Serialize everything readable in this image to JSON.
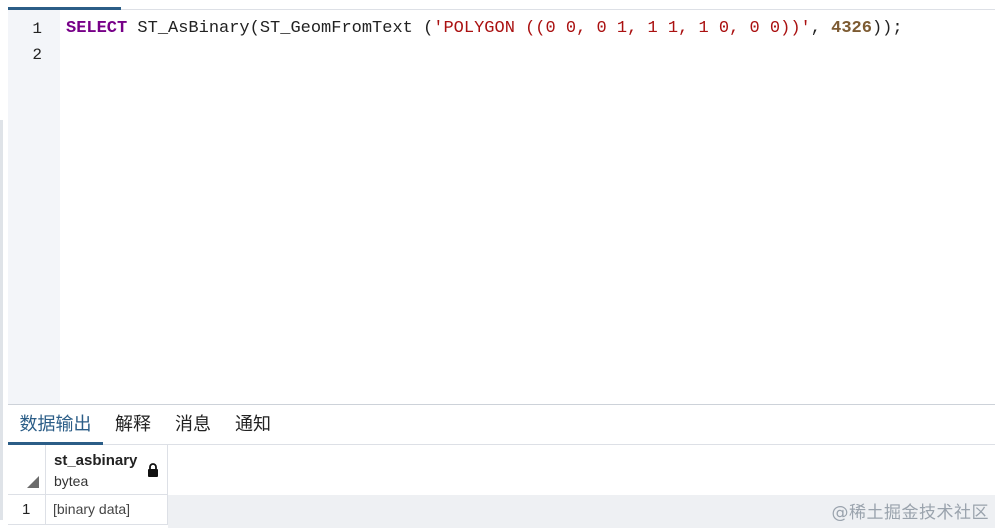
{
  "editor": {
    "line_numbers": [
      "1",
      "2"
    ],
    "code": {
      "keyword": "SELECT",
      "func_part": " ST_AsBinary(ST_GeomFromText (",
      "string_literal": "'POLYGON ((0 0, 0 1, 1 1, 1 0, 0 0))'",
      "sep": ", ",
      "srid": "4326",
      "end": "));"
    }
  },
  "result_tabs": [
    {
      "label": "数据输出",
      "active": true
    },
    {
      "label": "解释",
      "active": false
    },
    {
      "label": "消息",
      "active": false
    },
    {
      "label": "通知",
      "active": false
    }
  ],
  "grid": {
    "columns": [
      {
        "name": "st_asbinary",
        "type": "bytea",
        "icon": "lock-icon"
      }
    ],
    "rows": [
      {
        "row_number": "1",
        "cells": [
          "[binary data]"
        ]
      }
    ]
  },
  "watermark": "@稀土掘金技术社区",
  "colors": {
    "accent": "#2b5d87",
    "keyword": "#770088",
    "string": "#aa1111",
    "number": "#7d5b32",
    "gutter": "#f3f5f9"
  }
}
